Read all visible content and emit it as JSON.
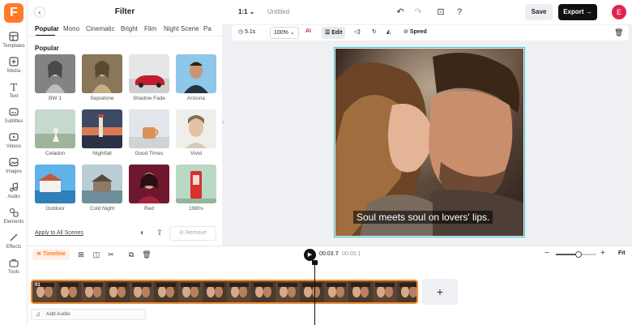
{
  "rail": {
    "logo": "F",
    "items": [
      {
        "label": "Templates",
        "icon": "templates-icon"
      },
      {
        "label": "Media",
        "icon": "media-icon"
      },
      {
        "label": "Text",
        "icon": "text-icon"
      },
      {
        "label": "Subtitles",
        "icon": "subtitles-icon"
      },
      {
        "label": "Videos",
        "icon": "videos-icon"
      },
      {
        "label": "Images",
        "icon": "images-icon"
      },
      {
        "label": "Audio",
        "icon": "audio-icon"
      },
      {
        "label": "Elements",
        "icon": "elements-icon"
      },
      {
        "label": "Effects",
        "icon": "effects-icon"
      },
      {
        "label": "Tools",
        "icon": "tools-icon"
      }
    ]
  },
  "panel": {
    "title": "Filter",
    "tabs": [
      "Popular",
      "Mono",
      "Cinematic",
      "Bright",
      "Film",
      "Night Scene",
      "Pa"
    ],
    "section": "Popular",
    "filters": [
      "BW 1",
      "Sepiatone",
      "Shadow Fade",
      "Arizona",
      "Celadon",
      "Nightfall",
      "Good Times",
      "Vivid",
      "Outdoor",
      "Cold Night",
      "Red",
      "1980s"
    ],
    "apply_all": "Apply to All Scenes",
    "remove": "Remove"
  },
  "topbar": {
    "ratio": "1:1",
    "title": "Untitled",
    "save": "Save",
    "export": "Export",
    "avatar": "E"
  },
  "edit_bar": {
    "duration": "5.1s",
    "zoom": "100%",
    "ai": "AI",
    "edit": "Edit",
    "speed": "Speed"
  },
  "canvas": {
    "caption": "Soul meets soul on lovers' lips."
  },
  "timeline": {
    "label": "Timeline",
    "current_time": "00:03.7",
    "separator": "/",
    "total_time": "00:05.1",
    "fit": "Fit",
    "zoom_level": 0.55,
    "clip_label": "01",
    "add_audio": "Add Audio",
    "add_clip": "+"
  },
  "colors": {
    "accent": "#ff7a29",
    "avatar": "#e0244a",
    "canvas_border": "#36c5d0"
  }
}
